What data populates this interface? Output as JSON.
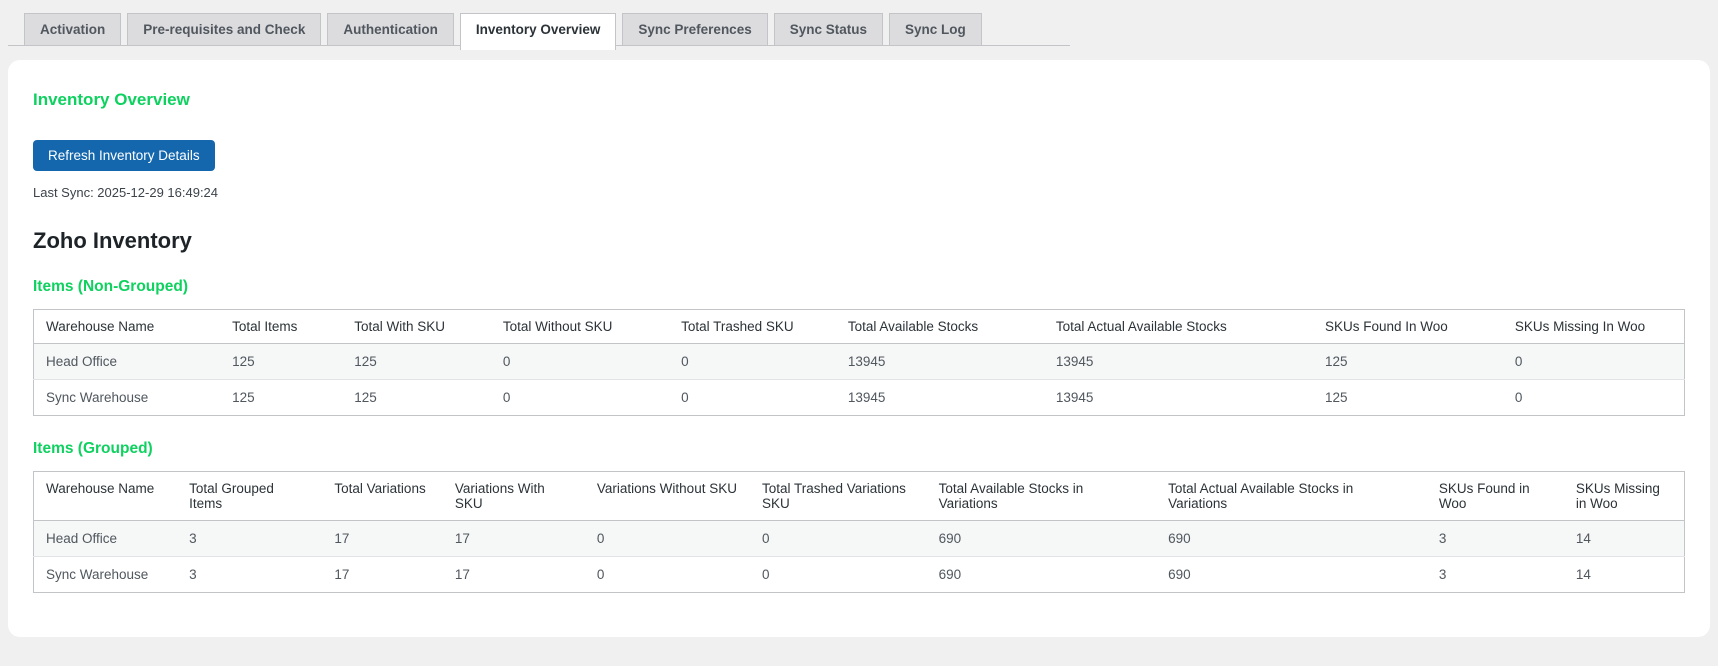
{
  "tabs": [
    {
      "label": "Activation",
      "active": false
    },
    {
      "label": "Pre-requisites and Check",
      "active": false
    },
    {
      "label": "Authentication",
      "active": false
    },
    {
      "label": "Inventory Overview",
      "active": true
    },
    {
      "label": "Sync Preferences",
      "active": false
    },
    {
      "label": "Sync Status",
      "active": false
    },
    {
      "label": "Sync Log",
      "active": false
    }
  ],
  "panel": {
    "title": "Inventory Overview",
    "refresh_button_label": "Refresh Inventory Details",
    "last_sync": "Last Sync: 2025-12-29 16:49:24",
    "section_title": "Zoho Inventory"
  },
  "non_grouped": {
    "heading": "Items (Non-Grouped)",
    "columns": [
      "Warehouse Name",
      "Total Items",
      "Total With SKU",
      "Total Without SKU",
      "Total Trashed SKU",
      "Total Available Stocks",
      "Total Actual Available Stocks",
      "SKUs Found In Woo",
      "SKUs Missing In Woo"
    ],
    "rows": [
      [
        "Head Office",
        "125",
        "125",
        "0",
        "0",
        "13945",
        "13945",
        "125",
        "0"
      ],
      [
        "Sync Warehouse",
        "125",
        "125",
        "0",
        "0",
        "13945",
        "13945",
        "125",
        "0"
      ]
    ]
  },
  "grouped": {
    "heading": "Items (Grouped)",
    "columns": [
      "Warehouse Name",
      "Total Grouped Items",
      "Total Variations",
      "Variations With SKU",
      "Variations Without SKU",
      "Total Trashed Variations SKU",
      "Total Available Stocks in Variations",
      "Total Actual Available Stocks in Variations",
      "SKUs Found in Woo",
      "SKUs Missing in Woo"
    ],
    "rows": [
      [
        "Head Office",
        "3",
        "17",
        "17",
        "0",
        "0",
        "690",
        "690",
        "3",
        "14"
      ],
      [
        "Sync Warehouse",
        "3",
        "17",
        "17",
        "0",
        "0",
        "690",
        "690",
        "3",
        "14"
      ]
    ]
  },
  "colors": {
    "accent_green": "#0ed15f",
    "button_blue": "#1467ad",
    "page_bg": "#f0f0f1",
    "tab_bg": "#dcdcde",
    "border_gray": "#c3c4c7",
    "stripe_row": "#f6f7f7"
  }
}
